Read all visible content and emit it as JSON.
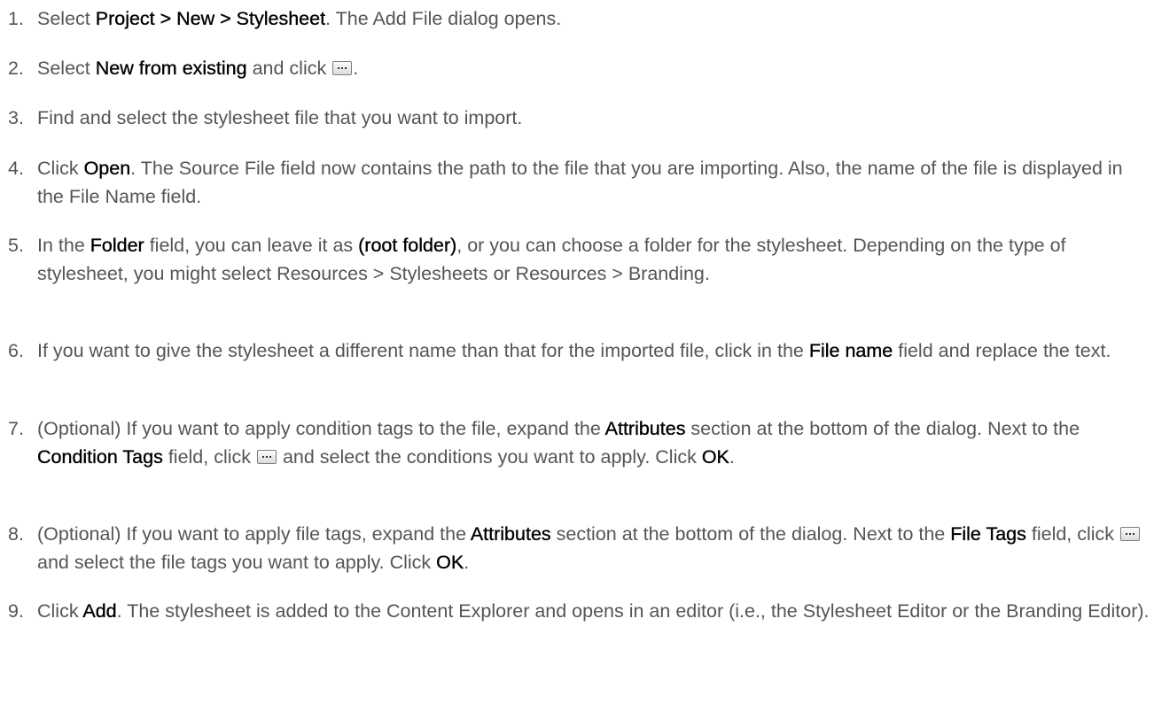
{
  "steps": [
    {
      "num": "1.",
      "parts": [
        "Select ",
        "Project > New > Stylesheet",
        ". The Add File dialog opens."
      ]
    },
    {
      "num": "2.",
      "parts": [
        "Select ",
        "New from existing",
        " and click ",
        "."
      ]
    },
    {
      "num": "3.",
      "text": "Find and select the stylesheet file that you want to import."
    },
    {
      "num": "4.",
      "parts": [
        "Click ",
        "Open",
        ". The Source File field now contains the path to the file that you are importing. Also, the name of the file is displayed in the File Name field."
      ]
    },
    {
      "num": "5.",
      "parts": [
        "In the ",
        "Folder",
        " field, you can leave it as ",
        "(root folder)",
        ", or you can choose a folder for the stylesheet. Depending on the type of stylesheet, you might select Resources > Stylesheets or Resources > Branding."
      ]
    },
    {
      "num": "6.",
      "parts": [
        "If you want to give the stylesheet a different name than that for the imported file, click in the ",
        "File name",
        " field and replace the text."
      ]
    },
    {
      "num": "7.",
      "parts": [
        "(Optional) If you want to apply condition tags to the file, expand the ",
        "Attributes",
        " section at the bottom of the dialog. Next to the ",
        "Condition Tags",
        " field, click ",
        " and select the conditions you want to apply. Click ",
        "OK",
        "."
      ]
    },
    {
      "num": "8.",
      "parts": [
        "(Optional) If you want to apply file tags, expand the ",
        "Attributes",
        " section at the bottom of the dialog. Next to the ",
        "File Tags",
        " field, click ",
        " and select the file tags you want to apply. Click ",
        "OK",
        "."
      ]
    },
    {
      "num": "9.",
      "parts": [
        "Click ",
        "Add",
        ". The stylesheet is added to the Content Explorer and opens in an editor (i.e., the Stylesheet Editor or the Branding Editor)."
      ]
    }
  ]
}
